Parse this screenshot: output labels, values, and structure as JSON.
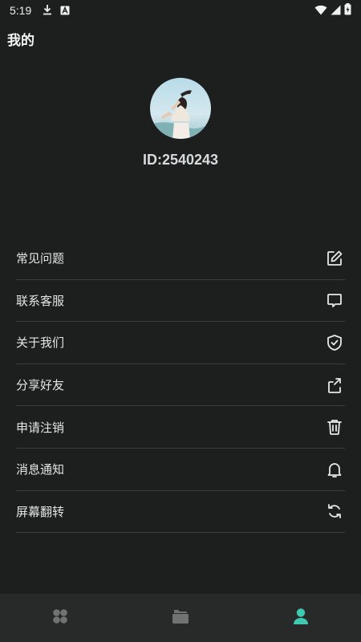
{
  "status_bar": {
    "time": "5:19",
    "icons_left": [
      "download-icon",
      "app-a-icon"
    ],
    "icons_right": [
      "wifi-icon",
      "signal-icon",
      "battery-charging-icon"
    ]
  },
  "header": {
    "title": "我的"
  },
  "profile": {
    "user_id": "ID:2540243",
    "avatar": "avatar"
  },
  "menu": {
    "items": [
      {
        "label": "常见问题",
        "icon": "edit-icon"
      },
      {
        "label": "联系客服",
        "icon": "chat-icon"
      },
      {
        "label": "关于我们",
        "icon": "shield-check-icon"
      },
      {
        "label": "分享好友",
        "icon": "share-icon"
      },
      {
        "label": "申请注销",
        "icon": "trash-icon"
      },
      {
        "label": "消息通知",
        "icon": "bell-icon"
      },
      {
        "label": "屏幕翻转",
        "icon": "rotate-icon"
      }
    ]
  },
  "bottom_nav": {
    "tabs": [
      {
        "icon": "home-grid-icon",
        "active": false
      },
      {
        "icon": "folder-icon",
        "active": false
      },
      {
        "icon": "user-icon",
        "active": true
      }
    ]
  },
  "colors": {
    "background": "#1c1f1e",
    "nav_background": "#272a29",
    "accent": "#3fc9b0",
    "icon_inactive": "#6f7473"
  }
}
